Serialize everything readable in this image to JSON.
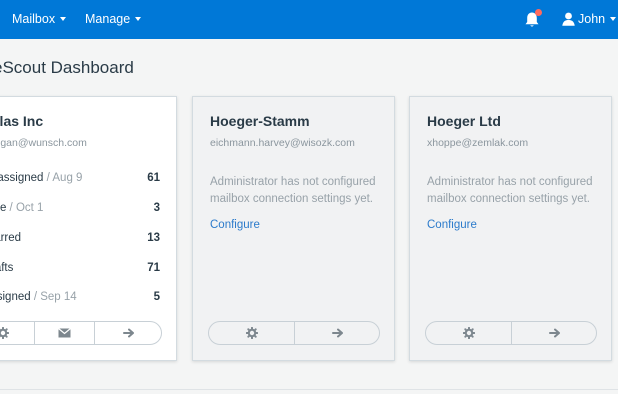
{
  "nav": {
    "mailbox": "Mailbox",
    "manage": "Manage",
    "user": "John"
  },
  "page": {
    "title": "eScout Dashboard"
  },
  "cards": [
    {
      "name": "ulas Inc",
      "email": "rogan@wunsch.com",
      "stats": [
        {
          "label": "nassigned",
          "date": " / Aug 9",
          "count": "61"
        },
        {
          "label": "ine",
          "date": " / Oct 1",
          "count": "3"
        },
        {
          "label": "tarred",
          "date": "",
          "count": "13"
        },
        {
          "label": "rafts",
          "date": "",
          "count": "71"
        },
        {
          "label": "ssigned",
          "date": " / Sep 14",
          "count": "5"
        }
      ]
    },
    {
      "name": "Hoeger-Stamm",
      "email": "eichmann.harvey@wisozk.com",
      "message": "Administrator has not configured mailbox connection settings yet.",
      "configure": "Configure"
    },
    {
      "name": "Hoeger Ltd",
      "email": "xhoppe@zemlak.com",
      "message": "Administrator has not configured mailbox connection settings yet.",
      "configure": "Configure"
    }
  ],
  "icons": {
    "settings": "gear-icon",
    "mail": "envelope-icon",
    "open": "arrow-right-icon",
    "notifications": "bell-icon",
    "user": "user-icon"
  },
  "colors": {
    "navbar": "#0078d7",
    "link": "#2c7bcb",
    "notification_dot": "#ff6a5e"
  }
}
